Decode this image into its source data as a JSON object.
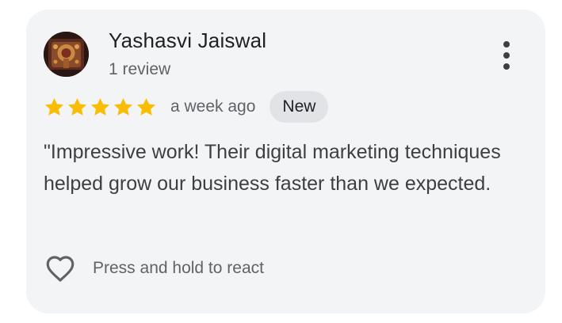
{
  "review": {
    "author_name": "Yashasvi Jaiswal",
    "review_count": "1 review",
    "rating": 5,
    "rating_max": 5,
    "time_ago": "a week ago",
    "badge": "New",
    "text": "\"Impressive work! Their digital marketing techniques helped grow our business faster than we expected.",
    "react_prompt": "Press and hold to react"
  },
  "icons": {
    "menu": "more-vert-icon",
    "star": "star-icon",
    "react": "heart-outline-icon"
  },
  "colors": {
    "card_background": "#f3f4f6",
    "star": "#fbbc04",
    "badge_background": "#e1e3e6",
    "primary_text": "#202124",
    "secondary_text": "#5f6368"
  }
}
